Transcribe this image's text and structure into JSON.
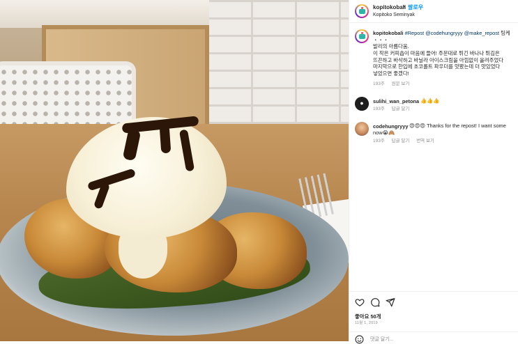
{
  "post": {
    "username": "kopitokobali",
    "dot": "•",
    "follow_label": "팔로우",
    "location": "Kopitoko Seminyak"
  },
  "caption": {
    "username": "kopitokobali",
    "repost_link": "#Repost",
    "mention1": "@codehungryyy",
    "mention2": "@make_repost",
    "line1_tail": "팅케",
    "line2": "・・・",
    "line3": "발리의 아름다움.",
    "line4": "이 작은 커피숍이 마음에 들어! 주문대로 튀긴 바나나 튀김은",
    "line5": "뜨끈하고 바삭하고 바닐라 아이스크림을 아낌없이 올려주었다",
    "line6": "마지막으로 한입에 초코롤트 파우더를 맛봤는데 더 맛있었다",
    "line7": "넣었으면 좋겠다!",
    "time": "193주",
    "action": "원문 보기"
  },
  "comments": [
    {
      "username": "sulihi_wan_petona",
      "text": "👍👍👍",
      "time": "193주",
      "reply": "답글 달기",
      "translate": ""
    },
    {
      "username": "codehungryyy",
      "text": "😍😍😍 Thanks for the repost! I want some",
      "text2": "now😭🙈",
      "time": "193주",
      "reply": "답글 달기",
      "translate": "번역 보기"
    }
  ],
  "actions": {
    "likes": "좋아요 50개",
    "date": "11월 1, 2019"
  },
  "add_comment": {
    "placeholder": "댓글 달기..."
  },
  "icons": {
    "like": "heart-icon",
    "comment": "comment-icon",
    "share": "share-icon",
    "emoji": "smile-icon"
  },
  "colors": {
    "link_blue": "#0095f6",
    "mention_blue": "#00376b",
    "meta_gray": "#8e8e8e"
  }
}
